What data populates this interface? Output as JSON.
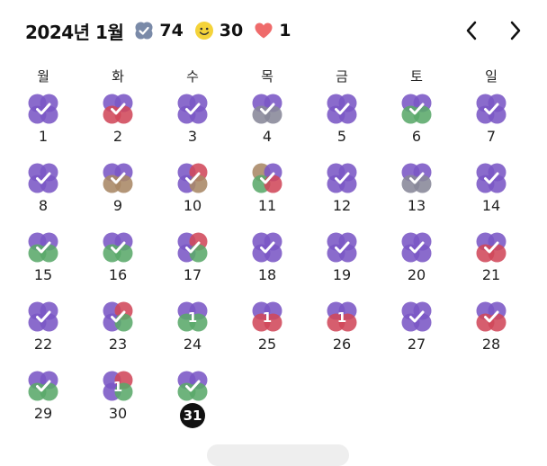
{
  "header": {
    "title": "2024년 1월",
    "stats": [
      {
        "icon": "clover-check-icon",
        "count": "74"
      },
      {
        "icon": "smiley-face-icon",
        "count": "30"
      },
      {
        "icon": "heart-icon",
        "count": "1"
      }
    ]
  },
  "weekdays": [
    "월",
    "화",
    "수",
    "목",
    "금",
    "토",
    "일"
  ],
  "colors": {
    "purple": "#7a57c5",
    "red": "#d0485a",
    "green": "#5aa86a",
    "gray": "#888899",
    "brown": "#a88865",
    "heart": "#ef6b6b",
    "smiley": "#f4d33a"
  },
  "days": [
    {
      "day": "1",
      "mark": "check",
      "petals": [
        "purple",
        "purple",
        "purple",
        "purple"
      ]
    },
    {
      "day": "2",
      "mark": "check",
      "petals": [
        "purple",
        "purple",
        "red",
        "red"
      ]
    },
    {
      "day": "3",
      "mark": "check",
      "petals": [
        "purple",
        "purple",
        "purple",
        "purple"
      ]
    },
    {
      "day": "4",
      "mark": "check",
      "petals": [
        "purple",
        "purple",
        "gray",
        "gray"
      ]
    },
    {
      "day": "5",
      "mark": "check",
      "petals": [
        "purple",
        "purple",
        "purple",
        "purple"
      ]
    },
    {
      "day": "6",
      "mark": "check",
      "petals": [
        "purple",
        "purple",
        "green",
        "green"
      ]
    },
    {
      "day": "7",
      "mark": "check",
      "petals": [
        "purple",
        "purple",
        "purple",
        "purple"
      ]
    },
    {
      "day": "8",
      "mark": "check",
      "petals": [
        "purple",
        "purple",
        "purple",
        "purple"
      ]
    },
    {
      "day": "9",
      "mark": "check",
      "petals": [
        "purple",
        "purple",
        "brown",
        "brown"
      ]
    },
    {
      "day": "10",
      "mark": "check",
      "petals": [
        "purple",
        "red",
        "purple",
        "brown"
      ]
    },
    {
      "day": "11",
      "mark": "check",
      "petals": [
        "brown",
        "purple",
        "green",
        "red"
      ]
    },
    {
      "day": "12",
      "mark": "check",
      "petals": [
        "purple",
        "purple",
        "purple",
        "purple"
      ]
    },
    {
      "day": "13",
      "mark": "check",
      "petals": [
        "purple",
        "purple",
        "gray",
        "gray"
      ]
    },
    {
      "day": "14",
      "mark": "check",
      "petals": [
        "purple",
        "purple",
        "purple",
        "purple"
      ]
    },
    {
      "day": "15",
      "mark": "check",
      "petals": [
        "purple",
        "purple",
        "green",
        "green"
      ]
    },
    {
      "day": "16",
      "mark": "check",
      "petals": [
        "purple",
        "purple",
        "green",
        "green"
      ]
    },
    {
      "day": "17",
      "mark": "check",
      "petals": [
        "purple",
        "red",
        "purple",
        "green"
      ]
    },
    {
      "day": "18",
      "mark": "check",
      "petals": [
        "purple",
        "purple",
        "purple",
        "purple"
      ]
    },
    {
      "day": "19",
      "mark": "check",
      "petals": [
        "purple",
        "purple",
        "purple",
        "purple"
      ]
    },
    {
      "day": "20",
      "mark": "check",
      "petals": [
        "purple",
        "purple",
        "purple",
        "purple"
      ]
    },
    {
      "day": "21",
      "mark": "check",
      "petals": [
        "purple",
        "purple",
        "red",
        "red"
      ]
    },
    {
      "day": "22",
      "mark": "check",
      "petals": [
        "purple",
        "purple",
        "purple",
        "purple"
      ]
    },
    {
      "day": "23",
      "mark": "check",
      "petals": [
        "purple",
        "red",
        "purple",
        "green"
      ]
    },
    {
      "day": "24",
      "mark": "1",
      "petals": [
        "purple",
        "purple",
        "green",
        "green"
      ]
    },
    {
      "day": "25",
      "mark": "1",
      "petals": [
        "purple",
        "purple",
        "red",
        "red"
      ]
    },
    {
      "day": "26",
      "mark": "1",
      "petals": [
        "purple",
        "purple",
        "red",
        "red"
      ]
    },
    {
      "day": "27",
      "mark": "check",
      "petals": [
        "purple",
        "purple",
        "purple",
        "purple"
      ]
    },
    {
      "day": "28",
      "mark": "check",
      "petals": [
        "purple",
        "purple",
        "red",
        "red"
      ]
    },
    {
      "day": "29",
      "mark": "check",
      "petals": [
        "purple",
        "purple",
        "green",
        "green"
      ]
    },
    {
      "day": "30",
      "mark": "1",
      "petals": [
        "purple",
        "red",
        "purple",
        "green"
      ]
    },
    {
      "day": "31",
      "mark": "check",
      "petals": [
        "purple",
        "purple",
        "green",
        "green"
      ],
      "today": true
    }
  ]
}
